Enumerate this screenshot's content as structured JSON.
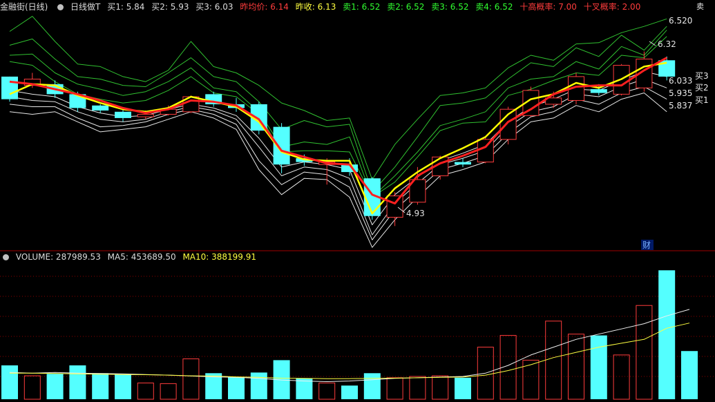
{
  "header": {
    "title": "金融街(日线)",
    "indicator": "日线做T",
    "buy1": "买1: 5.84",
    "buy2": "买2: 5.93",
    "buy3": "买3: 6.03",
    "prev_avg": "昨均价: 6.14",
    "prev_close": "昨收: 6.13",
    "sell1": "卖1: 6.52",
    "sell2": "卖2: 6.52",
    "sell3": "卖3: 6.52",
    "sell4": "卖4: 6.52",
    "rate1": "十高概率: 7.00",
    "rate2": "十叉概率: 2.00"
  },
  "volume_header": {
    "volume": "VOLUME: 287989.53",
    "ma5": "MA5: 453689.50",
    "ma10": "MA10: 388199.91"
  },
  "right_labels": {
    "sell_top": "6.520",
    "sell_top_tag": "卖",
    "buy3": "买3",
    "buy2": "买2",
    "buy1": "买1",
    "buy3_val": "6.033",
    "buy2_val": "5.935",
    "buy1_val": "5.837",
    "cai": "财"
  },
  "annotations": {
    "high": "6.32",
    "low": "4.93"
  },
  "colors": {
    "up": "#ff3c3c",
    "down": "#54ffff",
    "grid": "#8b0000",
    "sell_bands": "#30c030",
    "buy_bands": "#e8e8e8",
    "ma_fast": "#ffff00",
    "ma_slow": "#ff2020"
  },
  "chart_data": {
    "type": "candlestick",
    "price_ylim": [
      4.75,
      6.62
    ],
    "volume_ylim": [
      0,
      1050000
    ],
    "candles": [
      {
        "o": 6.12,
        "h": 6.12,
        "l": 5.92,
        "c": 5.94
      },
      {
        "o": 6.05,
        "h": 6.15,
        "l": 6.03,
        "c": 6.1
      },
      {
        "o": 6.06,
        "h": 6.09,
        "l": 5.95,
        "c": 5.98
      },
      {
        "o": 5.98,
        "h": 6.0,
        "l": 5.84,
        "c": 5.87
      },
      {
        "o": 5.89,
        "h": 5.9,
        "l": 5.83,
        "c": 5.85
      },
      {
        "o": 5.84,
        "h": 5.87,
        "l": 5.76,
        "c": 5.79
      },
      {
        "o": 5.8,
        "h": 5.85,
        "l": 5.78,
        "c": 5.82
      },
      {
        "o": 5.82,
        "h": 5.89,
        "l": 5.81,
        "c": 5.86
      },
      {
        "o": 5.84,
        "h": 5.97,
        "l": 5.83,
        "c": 5.96
      },
      {
        "o": 5.98,
        "h": 6.0,
        "l": 5.88,
        "c": 5.9
      },
      {
        "o": 5.9,
        "h": 5.95,
        "l": 5.84,
        "c": 5.87
      },
      {
        "o": 5.9,
        "h": 5.92,
        "l": 5.66,
        "c": 5.69
      },
      {
        "o": 5.72,
        "h": 5.75,
        "l": 5.35,
        "c": 5.42
      },
      {
        "o": 5.47,
        "h": 5.5,
        "l": 5.41,
        "c": 5.44
      },
      {
        "o": 5.42,
        "h": 5.47,
        "l": 5.26,
        "c": 5.44
      },
      {
        "o": 5.42,
        "h": 5.47,
        "l": 5.33,
        "c": 5.36
      },
      {
        "o": 5.31,
        "h": 5.32,
        "l": 4.98,
        "c": 5.01
      },
      {
        "o": 5.0,
        "h": 5.2,
        "l": 4.93,
        "c": 5.17
      },
      {
        "o": 5.12,
        "h": 5.4,
        "l": 5.1,
        "c": 5.3
      },
      {
        "o": 5.33,
        "h": 5.49,
        "l": 5.3,
        "c": 5.48
      },
      {
        "o": 5.44,
        "h": 5.47,
        "l": 5.4,
        "c": 5.42
      },
      {
        "o": 5.44,
        "h": 5.64,
        "l": 5.43,
        "c": 5.62
      },
      {
        "o": 5.62,
        "h": 5.88,
        "l": 5.58,
        "c": 5.86
      },
      {
        "o": 5.81,
        "h": 6.04,
        "l": 5.8,
        "c": 6.01
      },
      {
        "o": 5.9,
        "h": 6.0,
        "l": 5.87,
        "c": 5.95
      },
      {
        "o": 5.93,
        "h": 6.15,
        "l": 5.9,
        "c": 6.12
      },
      {
        "o": 6.02,
        "h": 6.06,
        "l": 5.97,
        "c": 5.99
      },
      {
        "o": 5.98,
        "h": 6.22,
        "l": 5.97,
        "c": 6.21
      },
      {
        "o": 6.03,
        "h": 6.32,
        "l": 6.0,
        "c": 6.26
      },
      {
        "o": 6.25,
        "h": 6.28,
        "l": 6.09,
        "c": 6.12
      }
    ],
    "volumes": [
      260000,
      180000,
      195000,
      260000,
      200000,
      190000,
      125000,
      120000,
      310000,
      200000,
      170000,
      205000,
      300000,
      160000,
      125000,
      105000,
      200000,
      165000,
      175000,
      180000,
      165000,
      400000,
      490000,
      300000,
      600000,
      500000,
      490000,
      340000,
      720000,
      990000,
      370000
    ],
    "ma_fast": [
      5.98,
      6.06,
      6.05,
      5.97,
      5.91,
      5.86,
      5.84,
      5.87,
      5.96,
      5.92,
      5.88,
      5.76,
      5.52,
      5.46,
      5.45,
      5.45,
      5.03,
      5.23,
      5.36,
      5.47,
      5.55,
      5.64,
      5.82,
      5.94,
      5.98,
      6.07,
      6.03,
      6.1,
      6.2,
      6.23
    ],
    "ma_slow": [
      6.08,
      6.06,
      6.02,
      5.98,
      5.93,
      5.87,
      5.83,
      5.86,
      5.93,
      5.92,
      5.89,
      5.78,
      5.53,
      5.48,
      5.43,
      5.42,
      5.18,
      5.11,
      5.33,
      5.43,
      5.49,
      5.56,
      5.76,
      5.86,
      5.98,
      6.04,
      6.05,
      6.05,
      6.17,
      6.27
    ],
    "sell_bands": [
      [
        6.48,
        6.6,
        6.4,
        6.22,
        6.2,
        6.12,
        6.08,
        6.17,
        6.4,
        6.2,
        6.15,
        6.05,
        5.91,
        5.85,
        5.77,
        5.79,
        5.3,
        5.58,
        5.78,
        5.97,
        5.99,
        6.03,
        6.19,
        6.29,
        6.25,
        6.38,
        6.39,
        6.47,
        6.52,
        6.58
      ],
      [
        6.37,
        6.42,
        6.26,
        6.12,
        6.1,
        6.05,
        6.04,
        6.15,
        6.27,
        6.12,
        6.08,
        5.92,
        5.7,
        5.77,
        5.72,
        5.74,
        5.2,
        5.4,
        5.64,
        5.89,
        5.91,
        5.95,
        6.1,
        6.23,
        6.2,
        6.35,
        6.28,
        6.45,
        6.33,
        6.52
      ],
      [
        6.29,
        6.3,
        6.15,
        6.06,
        6.02,
        5.97,
        6.0,
        6.08,
        6.19,
        6.03,
        6.0,
        5.84,
        5.56,
        5.6,
        5.58,
        5.64,
        5.16,
        5.33,
        5.52,
        5.73,
        5.78,
        5.84,
        6.03,
        6.1,
        6.12,
        6.24,
        6.18,
        6.36,
        6.29,
        6.49
      ],
      [
        6.24,
        6.21,
        6.08,
        5.98,
        5.94,
        5.91,
        5.93,
        6.01,
        6.12,
        5.99,
        5.96,
        5.82,
        5.52,
        5.53,
        5.53,
        5.52,
        5.16,
        5.28,
        5.48,
        5.69,
        5.75,
        5.76,
        5.97,
        6.02,
        6.09,
        6.15,
        6.13,
        6.29,
        6.27,
        6.44
      ]
    ],
    "buy_bands": [
      [
        6.01,
        5.98,
        5.96,
        5.88,
        5.83,
        5.8,
        5.81,
        5.86,
        5.9,
        5.87,
        5.81,
        5.63,
        5.4,
        5.44,
        5.42,
        5.38,
        4.94,
        5.18,
        5.32,
        5.45,
        5.51,
        5.58,
        5.76,
        5.88,
        5.94,
        6.02,
        6.01,
        6.09,
        6.16,
        6.12
      ],
      [
        5.96,
        5.93,
        5.92,
        5.84,
        5.78,
        5.76,
        5.78,
        5.84,
        5.88,
        5.85,
        5.78,
        5.56,
        5.33,
        5.4,
        5.38,
        5.31,
        4.86,
        5.11,
        5.27,
        5.42,
        5.47,
        5.53,
        5.72,
        5.84,
        5.88,
        5.98,
        5.96,
        6.04,
        6.1,
        6.03
      ],
      [
        5.9,
        5.88,
        5.88,
        5.79,
        5.72,
        5.73,
        5.76,
        5.82,
        5.86,
        5.82,
        5.74,
        5.45,
        5.26,
        5.36,
        5.34,
        5.24,
        4.82,
        5.06,
        5.22,
        5.38,
        5.43,
        5.49,
        5.67,
        5.8,
        5.84,
        5.94,
        5.9,
        5.99,
        6.04,
        5.94
      ],
      [
        5.84,
        5.82,
        5.84,
        5.76,
        5.68,
        5.7,
        5.72,
        5.78,
        5.84,
        5.79,
        5.7,
        5.38,
        5.18,
        5.31,
        5.3,
        5.16,
        4.76,
        4.98,
        5.16,
        5.33,
        5.38,
        5.44,
        5.62,
        5.76,
        5.79,
        5.89,
        5.84,
        5.94,
        5.99,
        5.84
      ]
    ],
    "vol_ma5": [
      205000,
      200000,
      205000,
      200000,
      198000,
      195000,
      190000,
      185000,
      178000,
      172000,
      168000,
      160000,
      148000,
      140000,
      135000,
      140000,
      150000,
      160000,
      165000,
      170000,
      175000,
      200000,
      260000,
      340000,
      400000,
      460000,
      500000,
      540000,
      580000,
      640000,
      690000
    ],
    "vol_ma10": [
      200000,
      200000,
      198000,
      195000,
      192000,
      190000,
      188000,
      185000,
      180000,
      178000,
      172000,
      168000,
      162000,
      160000,
      158000,
      158000,
      160000,
      162000,
      165000,
      168000,
      170000,
      185000,
      220000,
      265000,
      320000,
      360000,
      400000,
      430000,
      460000,
      545000,
      585000
    ]
  }
}
